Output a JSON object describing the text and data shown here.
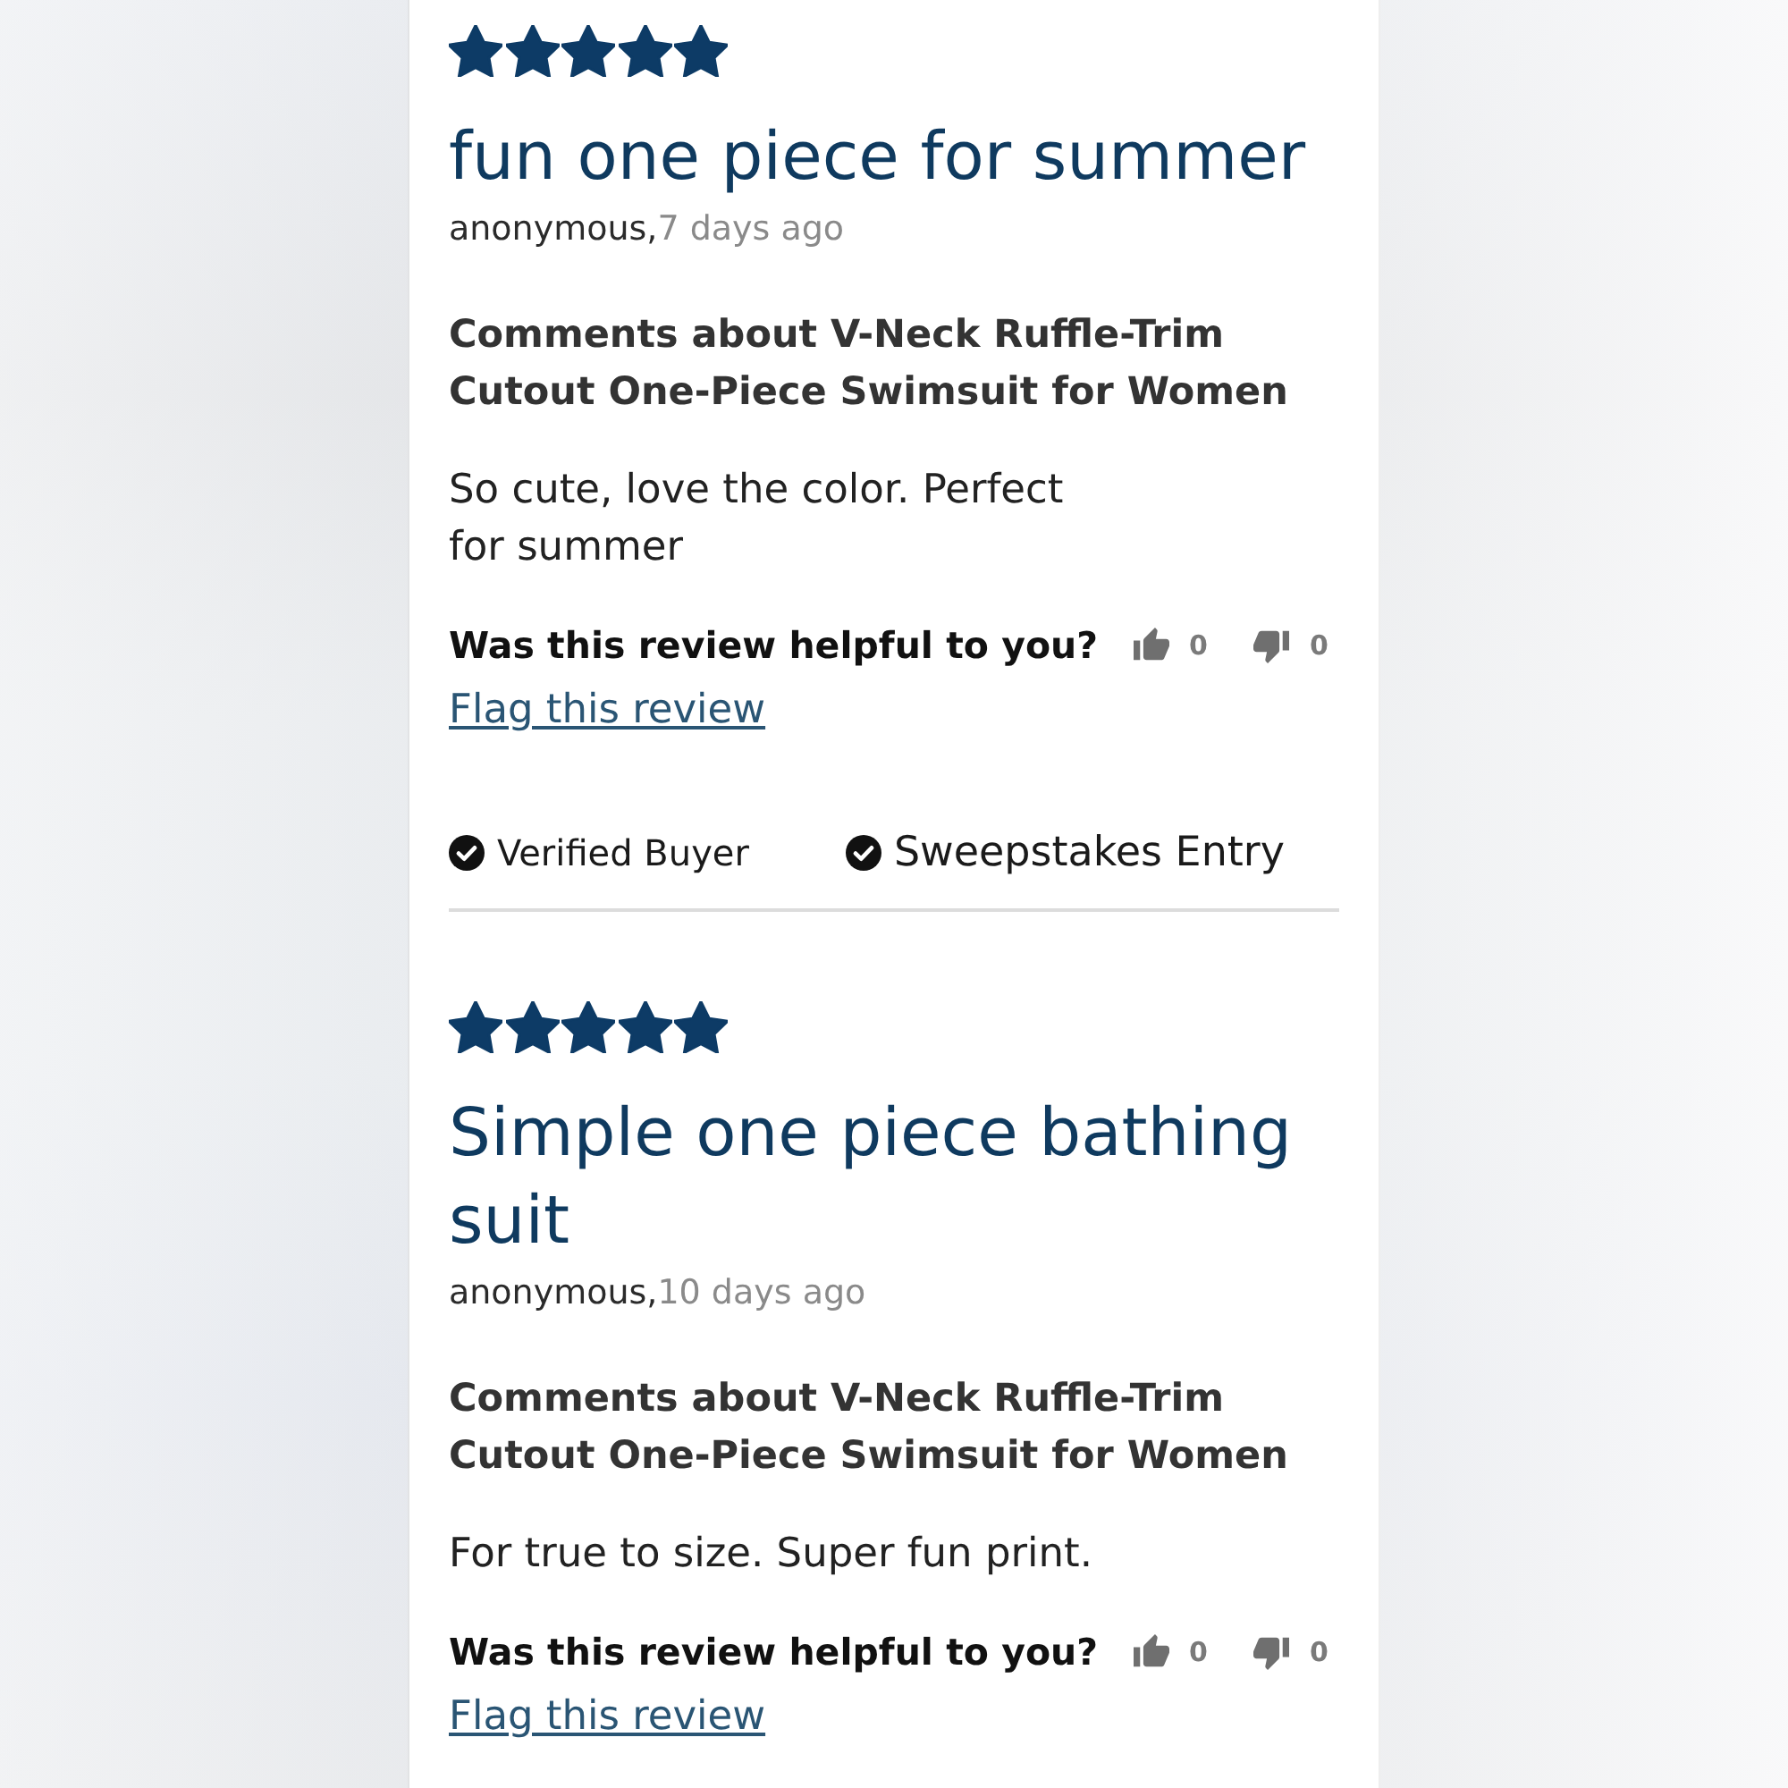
{
  "reviews": [
    {
      "stars": 5,
      "title": "fun one piece for summer",
      "author": "anonymous,",
      "date": "7 days ago",
      "heading": "Comments about V-Neck Ruffle-Trim Cutout One-Piece Swimsuit for Women",
      "body": "So cute, love the color. Perfect for summer",
      "helpful": {
        "question": "Was this review helpful to you?",
        "up_count": "0",
        "down_count": "0"
      },
      "flag_link": "Flag this review",
      "badges": [
        {
          "kind": "verified",
          "label": "Verified Buyer"
        },
        {
          "kind": "sweepstakes",
          "label": "Sweepstakes Entry"
        }
      ]
    },
    {
      "stars": 5,
      "title": "Simple one piece bathing suit",
      "author": "anonymous,",
      "date": "10 days ago",
      "heading": "Comments about V-Neck Ruffle-Trim Cutout One-Piece Swimsuit for Women",
      "body": "For true to size. Super fun print.",
      "helpful": {
        "question": "Was this review helpful to you?",
        "up_count": "0",
        "down_count": "0"
      },
      "flag_link": "Flag this review"
    }
  ]
}
